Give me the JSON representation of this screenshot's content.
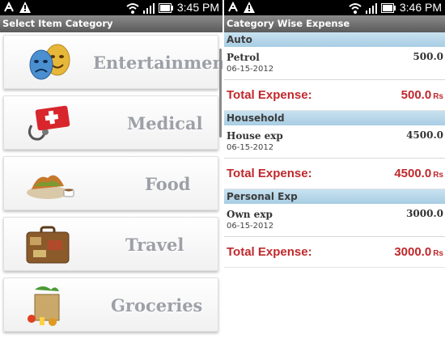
{
  "left_screen": {
    "status": {
      "time": "3:45 PM"
    },
    "title": "Select Item Category",
    "categories": [
      {
        "label": "Entertainment",
        "icon": "theater-masks-icon"
      },
      {
        "label": "Medical",
        "icon": "first-aid-kit-icon"
      },
      {
        "label": "Food",
        "icon": "food-platter-icon"
      },
      {
        "label": "Travel",
        "icon": "suitcase-icon"
      },
      {
        "label": "Groceries",
        "icon": "grocery-bag-icon"
      }
    ]
  },
  "right_screen": {
    "status": {
      "time": "3:46 PM"
    },
    "title": "Category Wise Expense",
    "sections": [
      {
        "header": "Auto",
        "entry_name": "Petrol",
        "entry_date": "06-15-2012",
        "entry_amount": "500.0",
        "total_label": "Total Expense:",
        "total_value": "500.0",
        "currency": "Rs"
      },
      {
        "header": "Household",
        "entry_name": "House exp",
        "entry_date": "06-15-2012",
        "entry_amount": "4500.0",
        "total_label": "Total Expense:",
        "total_value": "4500.0",
        "currency": "Rs"
      },
      {
        "header": "Personal Exp",
        "entry_name": "Own exp",
        "entry_date": "06-15-2012",
        "entry_amount": "3000.0",
        "total_label": "Total Expense:",
        "total_value": "3000.0",
        "currency": "Rs"
      }
    ]
  },
  "colors": {
    "title_bar": "#6e6e6e",
    "category_label": "#9ea0a8",
    "section_header": "#b8d8ea",
    "total_red": "#c0282c"
  }
}
